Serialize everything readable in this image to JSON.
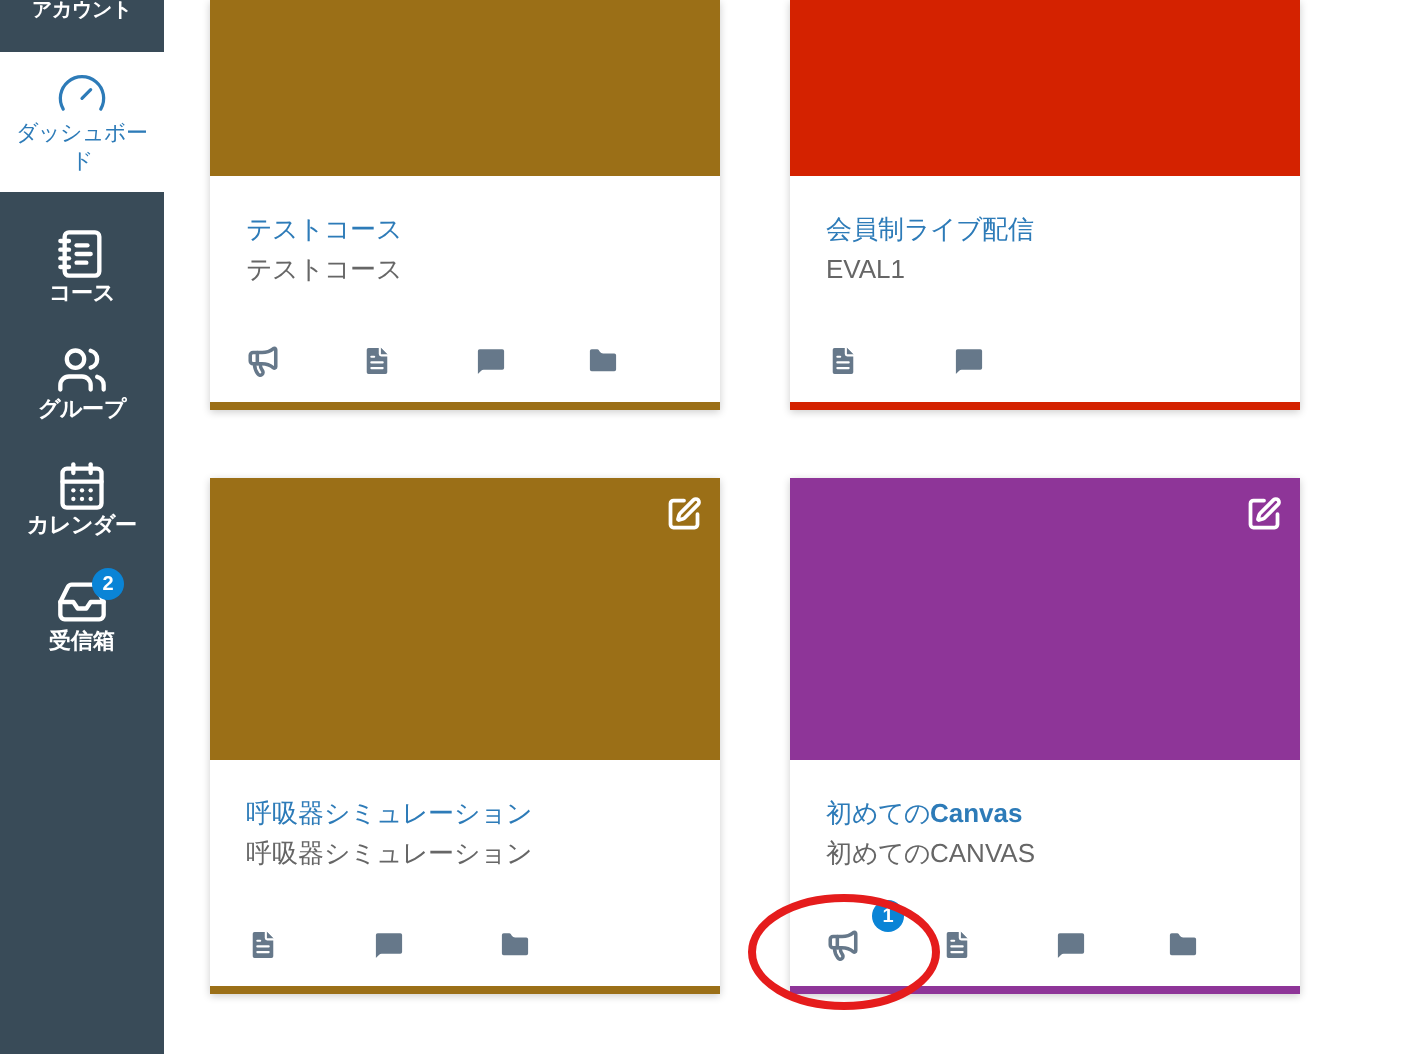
{
  "sidebar": {
    "items": [
      {
        "label": "アカウント",
        "kind": "account",
        "selected": false
      },
      {
        "label": "ダッシュボード",
        "kind": "dashboard",
        "selected": true
      },
      {
        "label": "コース",
        "kind": "courses",
        "selected": false
      },
      {
        "label": "グループ",
        "kind": "groups",
        "selected": false
      },
      {
        "label": "カレンダー",
        "kind": "calendar",
        "selected": false
      },
      {
        "label": "受信箱",
        "kind": "inbox",
        "selected": false,
        "badge": "2"
      }
    ]
  },
  "cards": [
    {
      "title": "テストコース",
      "subtitle": "テストコース",
      "color": "#9b6f17",
      "edit": false,
      "tools": [
        {
          "kind": "announcements"
        },
        {
          "kind": "assignments"
        },
        {
          "kind": "discussions"
        },
        {
          "kind": "files"
        }
      ]
    },
    {
      "title": "会員制ライブ配信",
      "subtitle": "EVAL1",
      "color": "#d42200",
      "edit": false,
      "tools": [
        {
          "kind": "assignments"
        },
        {
          "kind": "discussions"
        }
      ]
    },
    {
      "title": "呼吸器シミュレーション",
      "subtitle": "呼吸器シミュレーション",
      "color": "#9b6f17",
      "edit": true,
      "tools": [
        {
          "kind": "assignments"
        },
        {
          "kind": "discussions"
        },
        {
          "kind": "files"
        }
      ]
    },
    {
      "title": "初めての**Canvas**",
      "subtitle": "初めてのCANVAS",
      "color": "#8e3598",
      "edit": true,
      "tools": [
        {
          "kind": "announcements",
          "badge": "1",
          "circled": true
        },
        {
          "kind": "assignments"
        },
        {
          "kind": "discussions"
        },
        {
          "kind": "files"
        }
      ]
    }
  ]
}
